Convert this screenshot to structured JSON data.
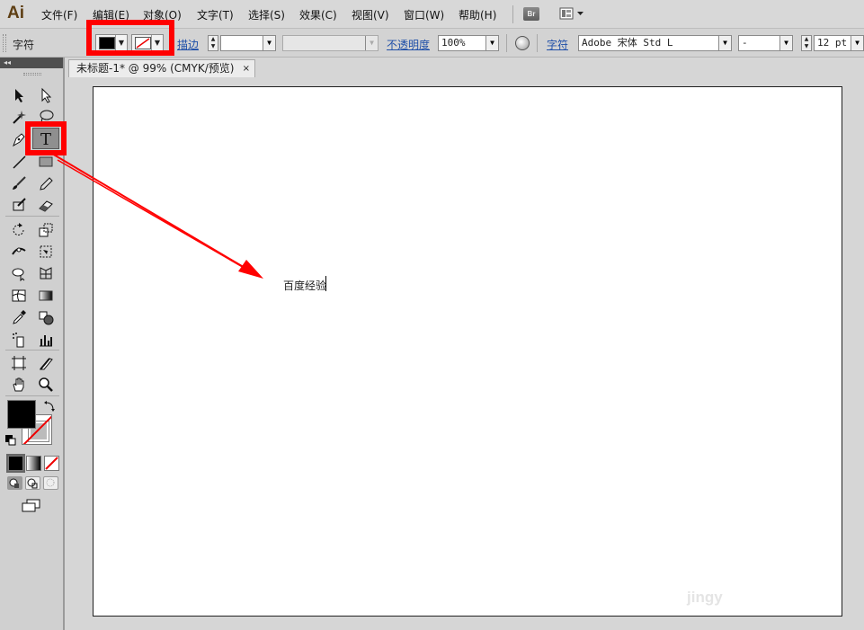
{
  "app": {
    "logo": "Ai"
  },
  "menu": {
    "items": [
      "文件(F)",
      "编辑(E)",
      "对象(O)",
      "文字(T)",
      "选择(S)",
      "效果(C)",
      "视图(V)",
      "窗口(W)",
      "帮助(H)"
    ],
    "bridge_button": "Br"
  },
  "control_bar": {
    "title": "字符",
    "fill_color": "#000000",
    "stroke_color": "none",
    "stroke_label": "描边",
    "stroke_weight": "",
    "stroke_style": "",
    "opacity_label": "不透明度",
    "opacity_value": "100%",
    "character_label": "字符",
    "font_family": "Adobe 宋体 Std L",
    "font_style": "-",
    "font_size": "12 pt"
  },
  "tools_panel": {
    "collapse_glyph": "◂◂",
    "selected_tool": "type-tool"
  },
  "document": {
    "tab_title": "未标题-1* @ 99% (CMYK/预览)",
    "tab_close": "×",
    "artboard_text": "百度经验"
  },
  "watermark": "jingy",
  "annotations": {
    "highlight_color": "#ff0000"
  }
}
